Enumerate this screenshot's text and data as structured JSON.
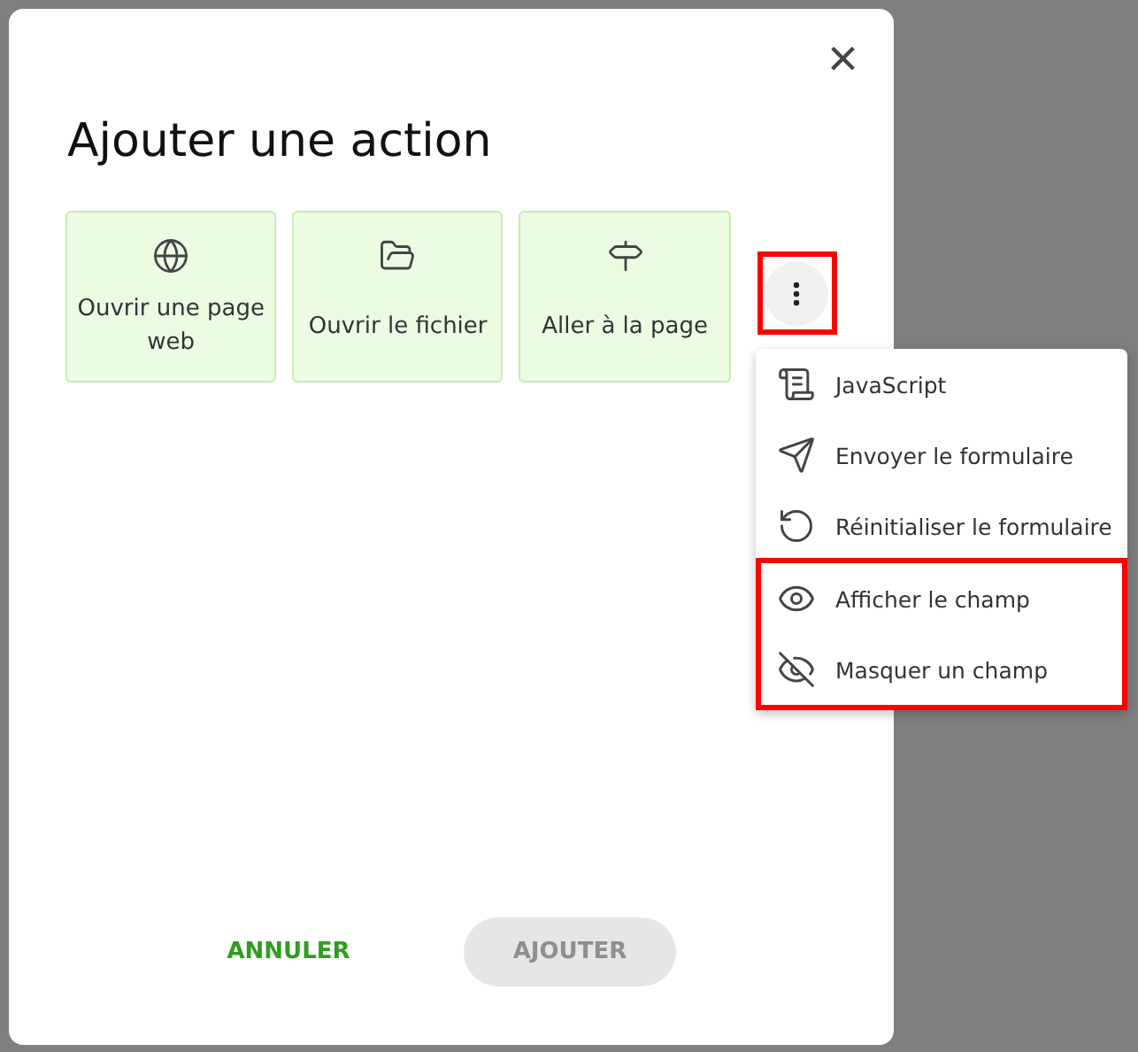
{
  "dialog": {
    "title": "Ajouter une action",
    "close": "×",
    "actions": [
      {
        "label": "Ouvrir une page web"
      },
      {
        "label": "Ouvrir le fichier"
      },
      {
        "label": "Aller à la page"
      }
    ],
    "more_button": {
      "highlighted": true
    },
    "menu": {
      "sections": [
        {
          "highlighted": false,
          "items": [
            {
              "label": "JavaScript"
            },
            {
              "label": "Envoyer le formulaire"
            },
            {
              "label": "Réinitialiser le formulaire"
            }
          ]
        },
        {
          "highlighted": true,
          "items": [
            {
              "label": "Afficher le champ"
            },
            {
              "label": "Masquer un champ"
            }
          ]
        }
      ]
    },
    "buttons": [
      {
        "label": "ANNULER",
        "disabled": false
      },
      {
        "label": "AJOUTER",
        "disabled": true
      }
    ]
  }
}
